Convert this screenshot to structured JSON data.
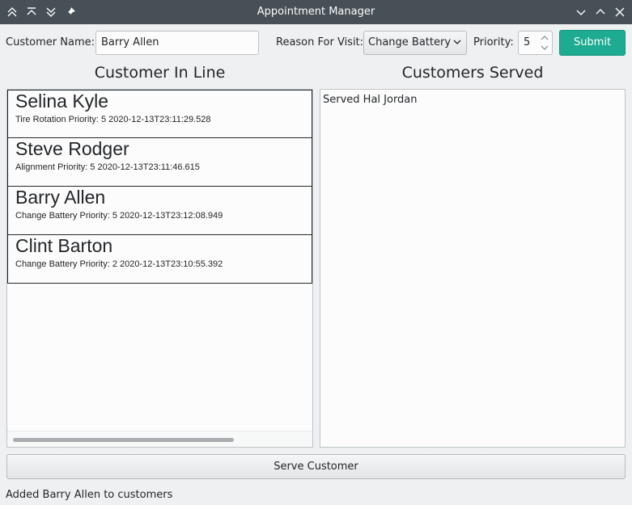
{
  "window": {
    "title": "Appointment Manager"
  },
  "form": {
    "name_label": "Customer Name:",
    "name_value": "Barry Allen",
    "reason_label": "Reason For Visit:",
    "reason_value": "Change Battery",
    "priority_label": "Priority:",
    "priority_value": "5",
    "submit_label": "Submit"
  },
  "line": {
    "heading": "Customer In Line",
    "customers": [
      {
        "name": "Selina Kyle",
        "detail": "Tire Rotation Priority: 5 2020-12-13T23:11:29.528"
      },
      {
        "name": "Steve Rodger",
        "detail": "Alignment Priority: 5 2020-12-13T23:11:46.615"
      },
      {
        "name": "Barry Allen",
        "detail": "Change Battery Priority: 5 2020-12-13T23:12:08.949"
      },
      {
        "name": "Clint Barton",
        "detail": "Change Battery Priority: 2 2020-12-13T23:10:55.392"
      }
    ]
  },
  "served": {
    "heading": "Customers Served",
    "items": [
      "Served Hal Jordan"
    ]
  },
  "serve_button_label": "Serve Customer",
  "status_text": "Added Barry Allen to customers",
  "colors": {
    "titlebar": "#475057",
    "accent": "#1dab91"
  }
}
